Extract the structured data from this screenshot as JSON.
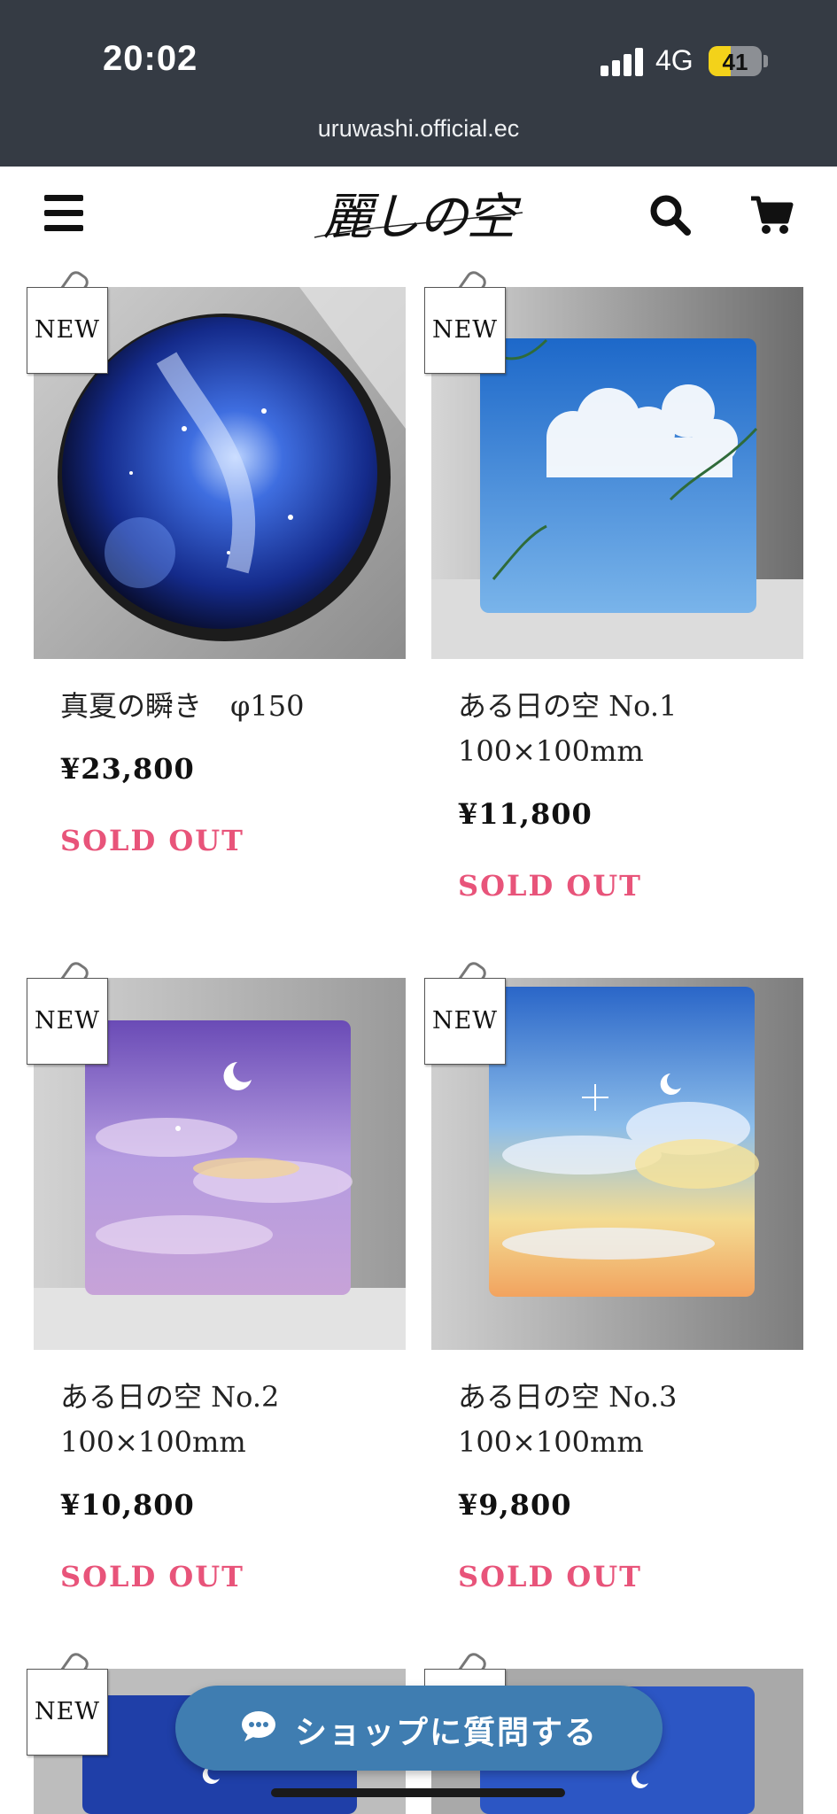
{
  "status_bar": {
    "time": "20:02",
    "network": "4G",
    "battery_level": "41",
    "battery_fraction": 0.41
  },
  "browser": {
    "url": "uruwashi.official.ec"
  },
  "header": {
    "logo_text": "麗しの空"
  },
  "colors": {
    "status_bg": "#353b44",
    "sold_out": "#e8547a",
    "chat_button": "#3f7db1"
  },
  "products": [
    {
      "badge": "NEW",
      "title": "真夏の瞬き　φ150",
      "price": "¥23,800",
      "status": "SOLD OUT"
    },
    {
      "badge": "NEW",
      "title": "ある日の空 No.1 100×100mm",
      "price": "¥11,800",
      "status": "SOLD OUT"
    },
    {
      "badge": "NEW",
      "title": "ある日の空 No.2 100×100mm",
      "price": "¥10,800",
      "status": "SOLD OUT"
    },
    {
      "badge": "NEW",
      "title": "ある日の空 No.3 100×100mm",
      "price": "¥9,800",
      "status": "SOLD OUT"
    },
    {
      "badge": "NEW"
    },
    {
      "badge": "NEW"
    }
  ],
  "chat_button": {
    "label": "ショップに質問する",
    "icon": "chat-bubble-icon"
  }
}
